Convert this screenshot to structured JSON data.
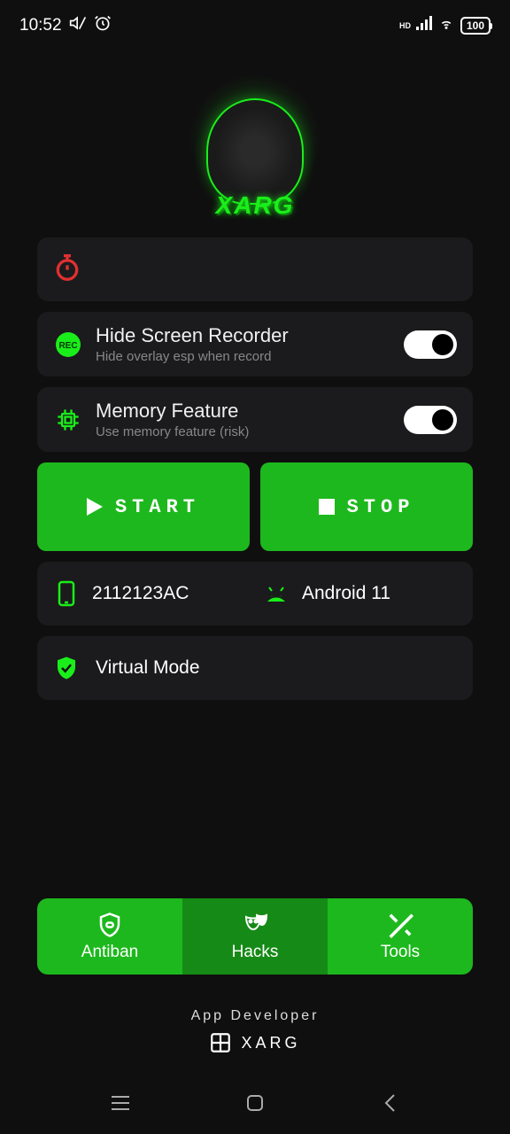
{
  "status": {
    "time": "10:52",
    "battery": "100",
    "hd": "HD"
  },
  "logo": {
    "text": "XARG"
  },
  "features": {
    "recorder": {
      "title": "Hide Screen Recorder",
      "subtitle": "Hide overlay esp when record"
    },
    "memory": {
      "title": "Memory Feature",
      "subtitle": "Use memory feature (risk)"
    }
  },
  "buttons": {
    "start": "START",
    "stop": "STOP"
  },
  "device": {
    "model": "2112123AC",
    "os": "Android 11",
    "mode": "Virtual Mode"
  },
  "tabs": {
    "antiban": "Antiban",
    "hacks": "Hacks",
    "tools": "Tools"
  },
  "footer": {
    "title": "App Developer",
    "brand": "XARG"
  }
}
